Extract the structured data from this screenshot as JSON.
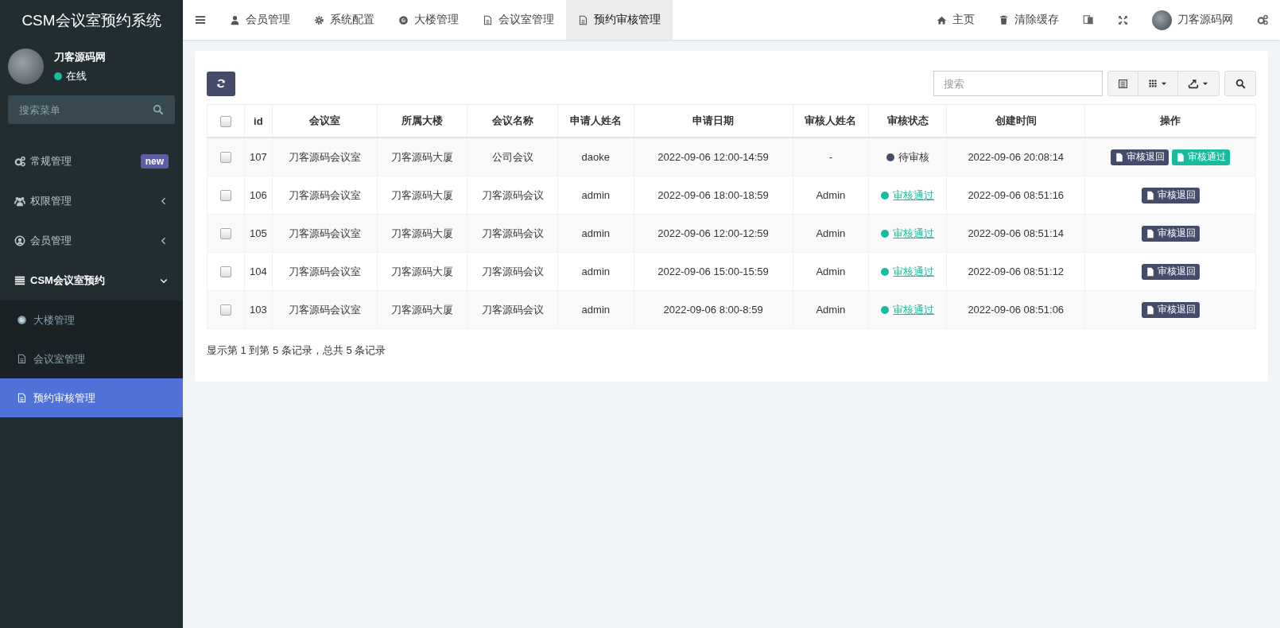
{
  "sidebar": {
    "brand": "CSM会议室预约系统",
    "user": {
      "name": "刀客源码网",
      "status": "在线",
      "online": true
    },
    "search": {
      "placeholder": "搜索菜单"
    },
    "items": [
      {
        "label": "常规管理",
        "badge": "new",
        "expanded": false
      },
      {
        "label": "权限管理",
        "expanded": false
      },
      {
        "label": "会员管理",
        "expanded": false
      },
      {
        "label": "CSM会议室预约",
        "expanded": true,
        "children": [
          {
            "label": "大楼管理",
            "selected": false
          },
          {
            "label": "会议室管理",
            "selected": false
          },
          {
            "label": "预约审核管理",
            "selected": true
          }
        ]
      }
    ]
  },
  "topbar": {
    "tabs": [
      {
        "label": "会员管理",
        "selected": false
      },
      {
        "label": "系统配置",
        "selected": false
      },
      {
        "label": "大楼管理",
        "selected": false
      },
      {
        "label": "会议室管理",
        "selected": false
      },
      {
        "label": "预约审核管理",
        "selected": true
      }
    ],
    "links": [
      {
        "label": "主页"
      },
      {
        "label": "清除缓存"
      }
    ],
    "user_name": "刀客源码网"
  },
  "toolbar": {
    "search": {
      "placeholder": "搜索"
    }
  },
  "table": {
    "header_checked": false,
    "columns": [
      "id",
      "会议室",
      "所属大楼",
      "会议名称",
      "申请人姓名",
      "申请日期",
      "审核人姓名",
      "审核状态",
      "创建时间",
      "操作"
    ],
    "rows": [
      {
        "checked": false,
        "cells": [
          "107",
          "刀客源码会议室",
          "刀客源码大厦",
          "公司会议",
          "daoke",
          "2022-09-06 12:00-14:59",
          "-"
        ],
        "status": {
          "label": "待审核",
          "kind": "pending",
          "color": "#444c69"
        },
        "created": "2022-09-06 20:08:14",
        "actions": [
          {
            "label": "审核退回",
            "kind": "reject"
          },
          {
            "label": "审核通过",
            "kind": "approve"
          }
        ]
      },
      {
        "checked": false,
        "cells": [
          "106",
          "刀客源码会议室",
          "刀客源码大厦",
          "刀客源码会议",
          "admin",
          "2022-09-06 18:00-18:59",
          "Admin"
        ],
        "status": {
          "label": "审核通过",
          "kind": "approved",
          "color": "#18bc9c"
        },
        "created": "2022-09-06 08:51:16",
        "actions": [
          {
            "label": "审核退回",
            "kind": "reject"
          }
        ]
      },
      {
        "checked": false,
        "cells": [
          "105",
          "刀客源码会议室",
          "刀客源码大厦",
          "刀客源码会议",
          "admin",
          "2022-09-06 12:00-12:59",
          "Admin"
        ],
        "status": {
          "label": "审核通过",
          "kind": "approved",
          "color": "#18bc9c"
        },
        "created": "2022-09-06 08:51:14",
        "actions": [
          {
            "label": "审核退回",
            "kind": "reject"
          }
        ]
      },
      {
        "checked": false,
        "cells": [
          "104",
          "刀客源码会议室",
          "刀客源码大厦",
          "刀客源码会议",
          "admin",
          "2022-09-06 15:00-15:59",
          "Admin"
        ],
        "status": {
          "label": "审核通过",
          "kind": "approved",
          "color": "#18bc9c"
        },
        "created": "2022-09-06 08:51:12",
        "actions": [
          {
            "label": "审核退回",
            "kind": "reject"
          }
        ]
      },
      {
        "checked": false,
        "cells": [
          "103",
          "刀客源码会议室",
          "刀客源码大厦",
          "刀客源码会议",
          "admin",
          "2022-09-06 8:00-8:59",
          "Admin"
        ],
        "status": {
          "label": "审核通过",
          "kind": "approved",
          "color": "#18bc9c"
        },
        "created": "2022-09-06 08:51:06",
        "actions": [
          {
            "label": "审核退回",
            "kind": "reject"
          }
        ]
      }
    ],
    "footer": "显示第 1 到第 5 条记录，总共 5 条记录"
  }
}
